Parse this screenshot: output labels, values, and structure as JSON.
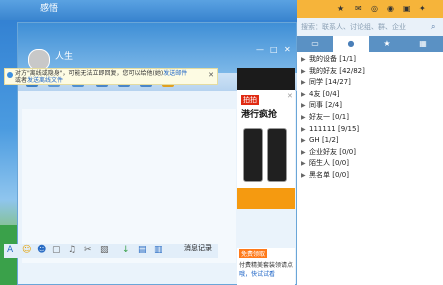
{
  "window": {
    "back_title": "感悟",
    "contact_name": "人生"
  },
  "notice": {
    "text1": "对方\"离线或隐身\"，可能无法立即回复，您可以给他(她)",
    "link1": "发送邮件",
    "text2": "或者",
    "link2": "发送离线文件"
  },
  "chat": {
    "message_record": "消息记录"
  },
  "ad": {
    "tag": "拍拍",
    "headline": "港行疯抢"
  },
  "ad2": {
    "tag": "免费领取",
    "line1": "付费精美套装领请点",
    "line2": "哦，快试试看"
  },
  "main": {
    "search_placeholder": "搜索：联系人、讨论组、群、企业",
    "tabs": [
      "消息",
      "联系人",
      "收藏",
      "群"
    ],
    "groups": [
      {
        "name": "我的设备",
        "count": "[1/1]"
      },
      {
        "name": "我的好友",
        "count": "[42/82]"
      },
      {
        "name": "同学",
        "count": "[14/27]"
      },
      {
        "name": "4友",
        "count": "[0/4]"
      },
      {
        "name": "同事",
        "count": "[2/4]"
      },
      {
        "name": "好友一",
        "count": "[0/1]"
      },
      {
        "name": "111111",
        "count": "[9/15]"
      },
      {
        "name": "GH",
        "count": "[1/2]"
      },
      {
        "name": "企业好友",
        "count": "[0/0]"
      },
      {
        "name": "陌生人",
        "count": "[0/0]"
      },
      {
        "name": "黑名单",
        "count": "[0/0]"
      }
    ]
  }
}
